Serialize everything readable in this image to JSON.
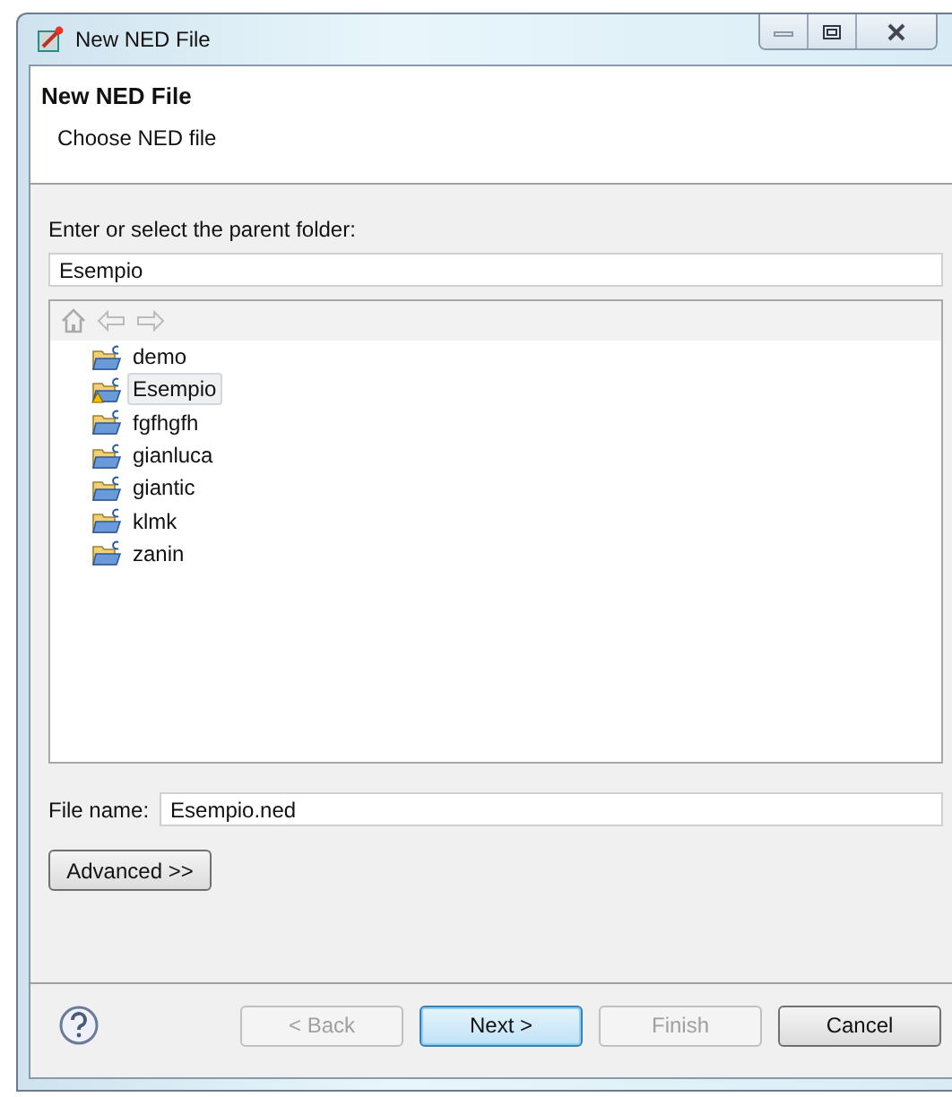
{
  "window": {
    "title": "New NED File"
  },
  "header": {
    "title": "New NED File",
    "description": "Choose NED file"
  },
  "folder": {
    "label": "Enter or select the parent folder:",
    "value": "Esempio"
  },
  "tree": {
    "items": [
      {
        "label": "demo",
        "selected": false,
        "warning": false
      },
      {
        "label": "Esempio",
        "selected": true,
        "warning": true
      },
      {
        "label": "fgfhgfh",
        "selected": false,
        "warning": false
      },
      {
        "label": "gianluca",
        "selected": false,
        "warning": false
      },
      {
        "label": "giantic",
        "selected": false,
        "warning": false
      },
      {
        "label": "klmk",
        "selected": false,
        "warning": false
      },
      {
        "label": "zanin",
        "selected": false,
        "warning": false
      }
    ]
  },
  "file_name": {
    "label": "File name:",
    "value": "Esempio.ned"
  },
  "advanced_button": "Advanced >>",
  "buttons": [
    {
      "label": "< Back",
      "disabled": true,
      "default": false
    },
    {
      "label": "Next >",
      "disabled": false,
      "default": true
    },
    {
      "label": "Finish",
      "disabled": true,
      "default": false
    },
    {
      "label": "Cancel",
      "disabled": false,
      "default": false
    }
  ]
}
